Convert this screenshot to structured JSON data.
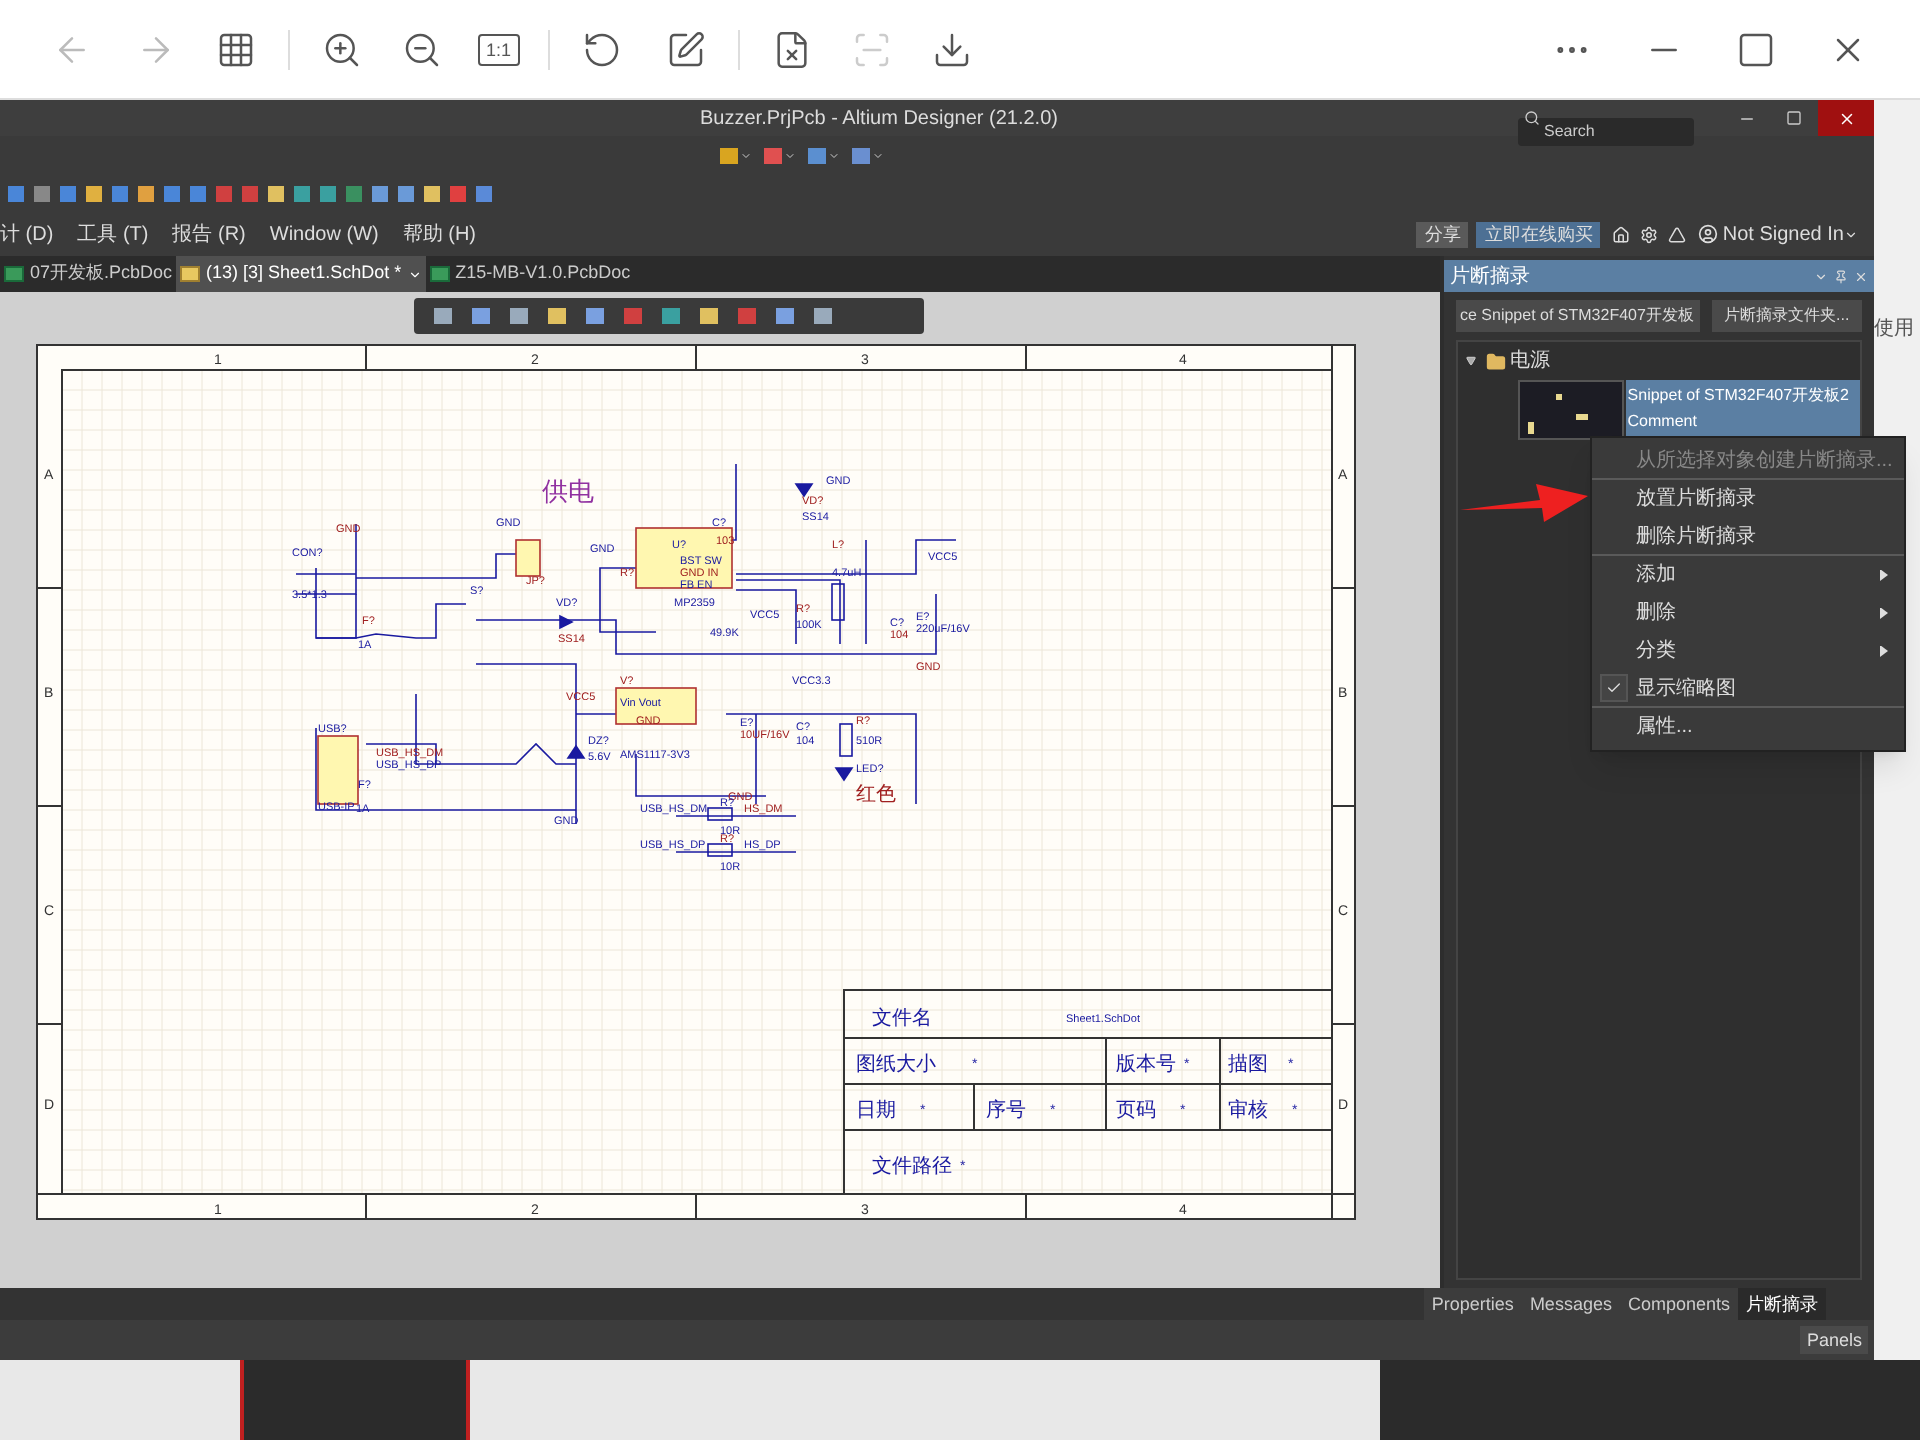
{
  "viewer_toolbar": {
    "zoom_label": "1:1"
  },
  "window": {
    "title": "Buzzer.PrjPcb - Altium Designer (21.2.0)",
    "search": {
      "placeholder": "Search"
    }
  },
  "menu": [
    "计 (D)",
    "工具 (T)",
    "报告 (R)",
    "Window (W)",
    "帮助 (H)"
  ],
  "header_buttons": {
    "share": "分享",
    "buy": "立即在线购买",
    "account": "Not Signed In"
  },
  "doc_tabs": [
    {
      "label": "07开发板.PcbDoc",
      "selected": false,
      "kind": "pcb"
    },
    {
      "label": "(13) [3] Sheet1.SchDot *",
      "selected": true,
      "kind": "sch"
    },
    {
      "label": "Z15-MB-V1.0.PcbDoc",
      "selected": false,
      "kind": "pcb"
    }
  ],
  "sheet": {
    "top_columns": [
      "1",
      "2",
      "3",
      "4"
    ],
    "bottom_columns": [
      "1",
      "2",
      "3",
      "4"
    ],
    "left_rows": [
      "A",
      "B",
      "C",
      "D"
    ],
    "right_rows": [
      "A",
      "B",
      "C",
      "D"
    ]
  },
  "schematic": {
    "title": "供电",
    "labels": [
      "GND",
      "CON?",
      "3.5*1.3",
      "F?",
      "1A",
      "GND",
      "JP?",
      "S?",
      "VD?",
      "SS14",
      "GND",
      "C?",
      "103",
      "U?",
      "BST  SW",
      "GND  IN",
      "FB     EN",
      "MP2359",
      "R?",
      "49.9K",
      "VCC5",
      "VD?",
      "SS14",
      "GND",
      "L?",
      "4.7uH",
      "VCC5",
      "R?",
      "100K",
      "C?",
      "104",
      "E?",
      "220uF/16V",
      "GND",
      "F?",
      "1A",
      "VCC5",
      "DZ?",
      "5.6V",
      "V?",
      "VCC3.3",
      "Vin   Vout",
      "GND",
      "AMS1117-3V3",
      "E?",
      "10UF/16V",
      "C?",
      "104",
      "R?",
      "510R",
      "LED?",
      "红色",
      "USB?",
      "USB-IP",
      "USB_HS_DM",
      "USB_HS_DP",
      "GND",
      "GND",
      "USB_HS_DM",
      "R?",
      "HS_DM",
      "10R",
      "USB_HS_DP",
      "R?",
      "HS_DP",
      "10R"
    ]
  },
  "title_block": {
    "file_name_label": "文件名",
    "file_name": "Sheet1.SchDot",
    "row_2": [
      {
        "label": "图纸大小",
        "value": "*"
      },
      {
        "label": "版本号",
        "value": "*"
      },
      {
        "label": "描图",
        "value": "*"
      }
    ],
    "row_3": [
      {
        "label": "日期",
        "value": "*"
      },
      {
        "label": "序号",
        "value": "*"
      },
      {
        "label": "页码",
        "value": "*"
      },
      {
        "label": "审核",
        "value": "*"
      }
    ],
    "path_label": "文件路径",
    "path_value": "*"
  },
  "panel": {
    "title": "片断摘录",
    "place_button": "ce Snippet of STM32F407开发板",
    "folder_button": "片断摘录文件夹...",
    "tree": [
      {
        "label": "电源",
        "expanded": true,
        "children": [
          {
            "label": "Snippet of STM32F407开发板2",
            "comment": "Comment",
            "selected": true
          }
        ]
      }
    ]
  },
  "context_menu": [
    {
      "label": "从所选择对象创建片断摘录...",
      "disabled": true,
      "submenu": false,
      "checked": false,
      "separator_after": true
    },
    {
      "label": "放置片断摘录",
      "disabled": false,
      "submenu": false,
      "checked": false,
      "separator_after": false
    },
    {
      "label": "删除片断摘录",
      "disabled": false,
      "submenu": false,
      "checked": false,
      "separator_after": true
    },
    {
      "label": "添加",
      "disabled": false,
      "submenu": true,
      "checked": false,
      "separator_after": false
    },
    {
      "label": "删除",
      "disabled": false,
      "submenu": true,
      "checked": false,
      "separator_after": false
    },
    {
      "label": "分类",
      "disabled": false,
      "submenu": true,
      "checked": false,
      "separator_after": false
    },
    {
      "label": "显示缩略图",
      "disabled": false,
      "submenu": false,
      "checked": true,
      "separator_after": true
    },
    {
      "label": "属性...",
      "disabled": false,
      "submenu": false,
      "checked": false,
      "separator_after": false
    }
  ],
  "panel_tabs": [
    {
      "label": "Properties",
      "selected": false
    },
    {
      "label": "Messages",
      "selected": false
    },
    {
      "label": "Components",
      "selected": false
    },
    {
      "label": "片断摘录",
      "selected": true
    }
  ],
  "status_bar": {
    "panels_button": "Panels"
  },
  "background_page": {
    "text": "使用"
  }
}
